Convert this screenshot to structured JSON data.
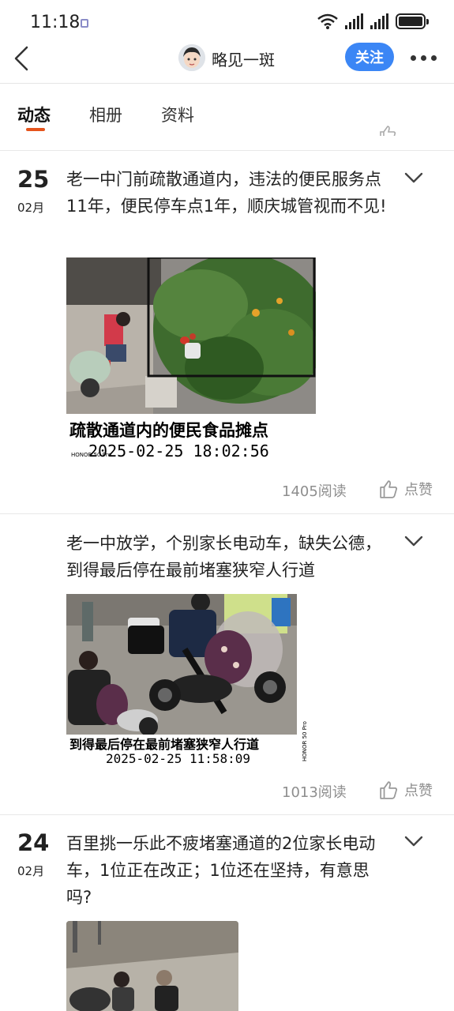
{
  "status_bar": {
    "time": "11:18"
  },
  "nav": {
    "username": "略见一斑",
    "follow_label": "关注"
  },
  "tabs": [
    {
      "label": "动态",
      "active": true
    },
    {
      "label": "相册",
      "active": false
    },
    {
      "label": "资料",
      "active": false
    }
  ],
  "posts": [
    {
      "day": "25",
      "month": "02月",
      "text": "老一中门前疏散通道内，违法的便民服务点11年，便民停车点1年，顺庆城管视而不见!",
      "image": {
        "caption": "疏散通道内的便民食品摊点",
        "timestamp": "2025-02-25 18:02:56",
        "brand": "HONOR 50 Pro"
      },
      "reads": "1405阅读",
      "like_label": "点赞"
    },
    {
      "text": "老一中放学，个别家长电动车，缺失公德，到得最后停在最前堵塞狭窄人行道",
      "image": {
        "caption": "到得最后停在最前堵塞狭窄人行道",
        "timestamp": "2025-02-25 11:58:09",
        "brand": "HONOR 50 Pro"
      },
      "reads": "1013阅读",
      "like_label": "点赞"
    },
    {
      "day": "24",
      "month": "02月",
      "text": "百里挑一乐此不疲堵塞通道的2位家长电动车，1位正在改正；1位还在坚持，有意思吗?"
    }
  ]
}
